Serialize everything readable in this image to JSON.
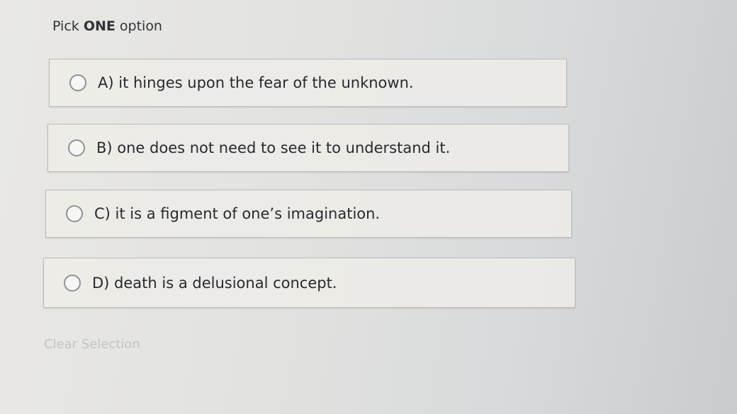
{
  "prompt": {
    "prefix": "Pick ",
    "emphasis": "ONE",
    "suffix": " option"
  },
  "options": [
    {
      "label": "A) it hinges upon the fear of the unknown.",
      "selected": false
    },
    {
      "label": "B) one does not need to see it to understand it.",
      "selected": false
    },
    {
      "label": "C) it is a figment of one’s imagination.",
      "selected": false
    },
    {
      "label": "D) death is a delusional concept.",
      "selected": false
    }
  ],
  "clear_selection": {
    "label": "Clear Selection"
  },
  "icons": {
    "radio": "radio-unchecked-icon"
  },
  "colors": {
    "option_border": "#b9bbbd",
    "radio_border": "#8f9295",
    "clear_text": "#c2c4c6"
  }
}
